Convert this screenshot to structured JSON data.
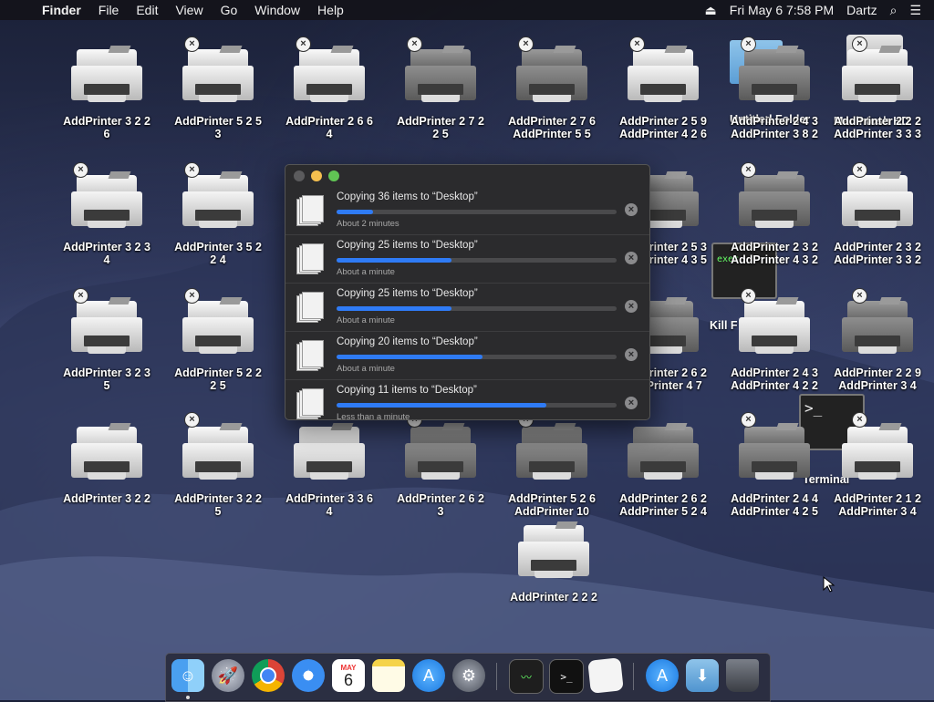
{
  "menubar": {
    "apple": "",
    "app_name": "Finder",
    "menus": [
      "File",
      "Edit",
      "View",
      "Go",
      "Window",
      "Help"
    ],
    "eject": "⏏",
    "datetime": "Fri May 6  7:58 PM",
    "user": "Dartz",
    "search": "⌕",
    "list": "☰"
  },
  "desktop": {
    "icons": [
      {
        "label": "AddPrinter 3 2 2\n6"
      },
      {
        "label": "AddPrinter 5 2 5\n3"
      },
      {
        "label": "AddPrinter 2 6 6\n4"
      },
      {
        "label": "AddPrinter 2 7 2\n2 5"
      },
      {
        "label": "AddPrinter 2 7 6\nAddPrinter 5 5"
      },
      {
        "label": "AddPrinter 2 5 9\nAddPrinter 4 2 6"
      },
      {
        "label": "AddPrinter 2 4 3\nAddPrinter 3 8 2"
      },
      {
        "label": "AddPrinter 2 2 2\nAddPrinter 3 3 3"
      },
      {
        "label": "AddPrinter 3 2 3\n4"
      },
      {
        "label": "AddPrinter 3 5 2\n2 4"
      },
      {
        "label": "AddPrinter 2 5 3\nAddPrinter 4 3 5"
      },
      {
        "label": "AddPrinter 2 3 2\nAddPrinter 4 3 2"
      },
      {
        "label": "AddPrinter 2 3 2\nAddPrinter 3 3 2"
      },
      {
        "label": "AddPrinter 3 2 3\n5"
      },
      {
        "label": "AddPrinter 5 2 2\n2 5"
      },
      {
        "label": "AddPrinter 2 6 2\nAddPrinter 4 7"
      },
      {
        "label": "AddPrinter 2 4 3\nAddPrinter 4 2 2"
      },
      {
        "label": "AddPrinter 2 2 9\nAddPrinter 3 4"
      },
      {
        "label": "AddPrinter 3 2 2"
      },
      {
        "label": "AddPrinter 3 2 2\n5"
      },
      {
        "label": "AddPrinter 3 3 6\n4"
      },
      {
        "label": "AddPrinter 2 6 2\n3"
      },
      {
        "label": "AddPrinter 5 2 6\nAddPrinter 10"
      },
      {
        "label": "AddPrinter 2 6 2\nAddPrinter 5 2 4"
      },
      {
        "label": "AddPrinter 2 4 4\nAddPrinter 4 2 5"
      },
      {
        "label": "AddPrinter 2 1 2\nAddPrinter 3 4"
      },
      {
        "label": "AddPrinter 2 2 2"
      }
    ],
    "bg_labels": [
      "Untitled Folder",
      "Macintosh HD",
      "Kill F",
      "Terminal",
      "exec"
    ],
    "terminal_prompt": ">_"
  },
  "copy_window": {
    "close_glyph": "×",
    "jobs": [
      {
        "title": "Copying 36 items to “Desktop”",
        "status": "About 2 minutes",
        "progress": 0.13
      },
      {
        "title": "Copying 25 items to “Desktop”",
        "status": "About a minute",
        "progress": 0.41
      },
      {
        "title": "Copying 25 items to “Desktop”",
        "status": "About a minute",
        "progress": 0.41
      },
      {
        "title": "Copying 20 items to “Desktop”",
        "status": "About a minute",
        "progress": 0.52
      },
      {
        "title": "Copying 11 items to “Desktop”",
        "status": "Less than a minute",
        "progress": 0.75
      }
    ]
  },
  "dock": {
    "items": [
      "finder-icon",
      "launchpad-icon",
      "chrome-icon",
      "safari-icon",
      "calendar-icon",
      "notes-icon",
      "app-store-icon",
      "system-preferences-icon",
      "activity-monitor-icon",
      "terminal-icon",
      "textedit-icon",
      "app-store-icon-2",
      "downloads-folder-icon",
      "trash-icon"
    ],
    "calendar_month": "MAY",
    "calendar_day": "6"
  }
}
